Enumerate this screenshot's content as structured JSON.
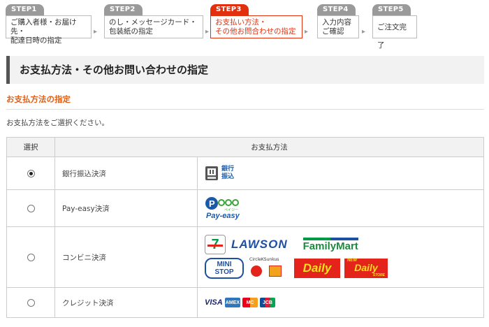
{
  "steps": [
    {
      "tab": "STEP1",
      "lines": [
        "ご購入者様・お届け先・",
        "配達日時の指定"
      ]
    },
    {
      "tab": "STEP2",
      "lines": [
        "のし・メッセージカード・",
        "包装紙の指定"
      ]
    },
    {
      "tab": "STEP3",
      "lines": [
        "お支払い方法・",
        "その他お問合わせの指定"
      ],
      "active": true
    },
    {
      "tab": "STEP4",
      "lines": [
        "入力内容",
        "ご確認"
      ]
    },
    {
      "tab": "STEP5",
      "lines": [
        "ご注文完了"
      ]
    }
  ],
  "page_title": "お支払方法・その他お問い合わせの指定",
  "section_title": "お支払方法の指定",
  "description": "お支払方法をご選択ください。",
  "table": {
    "header_select": "選択",
    "header_method": "お支払方法",
    "rows": [
      {
        "name": "銀行振込決済",
        "selected": true
      },
      {
        "name": "Pay-easy決済",
        "selected": false
      },
      {
        "name": "コンビニ決済",
        "selected": false
      },
      {
        "name": "クレジット決済",
        "selected": false
      }
    ]
  },
  "logos": {
    "bank_line1": "銀行",
    "bank_line2": "振込",
    "payeasy": "Pay-easy",
    "payeasy_sub": "ペイジー",
    "seven": "7",
    "lawson": "LAWSON",
    "familymart": "FamilyMart",
    "ministop_1": "MINI",
    "ministop_2": "STOP",
    "circlek": "CircleKSunkus",
    "daily1": "Daily",
    "daily2": "Daily",
    "daily2_top": "NEW",
    "daily2_sub": "STORE",
    "visa": "VISA",
    "amex": "AMEX",
    "master": "MC",
    "jcb": "JCB"
  },
  "colors": {
    "accent": "#e2300f",
    "section": "#e0611a",
    "step_inactive": "#9a9a9a"
  }
}
